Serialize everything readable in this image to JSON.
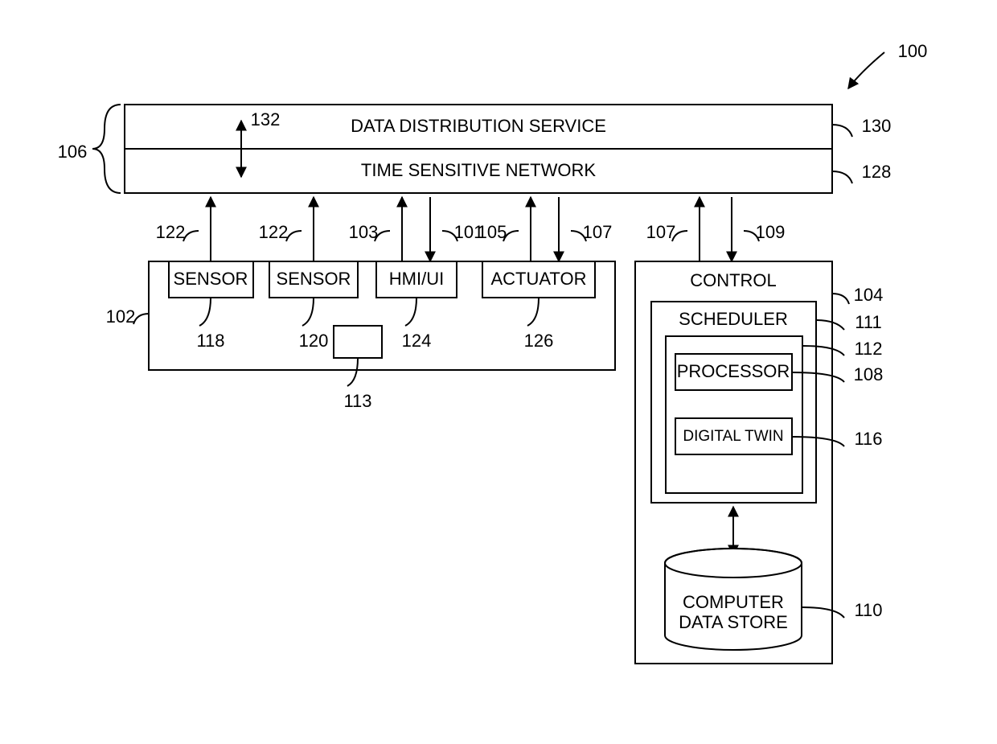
{
  "labels": {
    "dds": "DATA DISTRIBUTION SERVICE",
    "tsn": "TIME SENSITIVE NETWORK",
    "sensor1": "SENSOR",
    "sensor2": "SENSOR",
    "hmi": "HMI/UI",
    "actuator": "ACTUATOR",
    "control": "CONTROL",
    "scheduler": "SCHEDULER",
    "processor": "PROCESSOR",
    "digitaltwin": "DIGITAL TWIN",
    "datastore1": "COMPUTER",
    "datastore2": "DATA STORE"
  },
  "refs": {
    "r100": "100",
    "r106": "106",
    "r132": "132",
    "r130": "130",
    "r128": "128",
    "r122a": "122",
    "r122b": "122",
    "r103": "103",
    "r101": "101",
    "r105": "105",
    "r107a": "107",
    "r107b": "107",
    "r109": "109",
    "r102": "102",
    "r118": "118",
    "r120": "120",
    "r124": "124",
    "r126": "126",
    "r113": "113",
    "r104": "104",
    "r111": "111",
    "r112": "112",
    "r108": "108",
    "r116": "116",
    "r110": "110"
  }
}
